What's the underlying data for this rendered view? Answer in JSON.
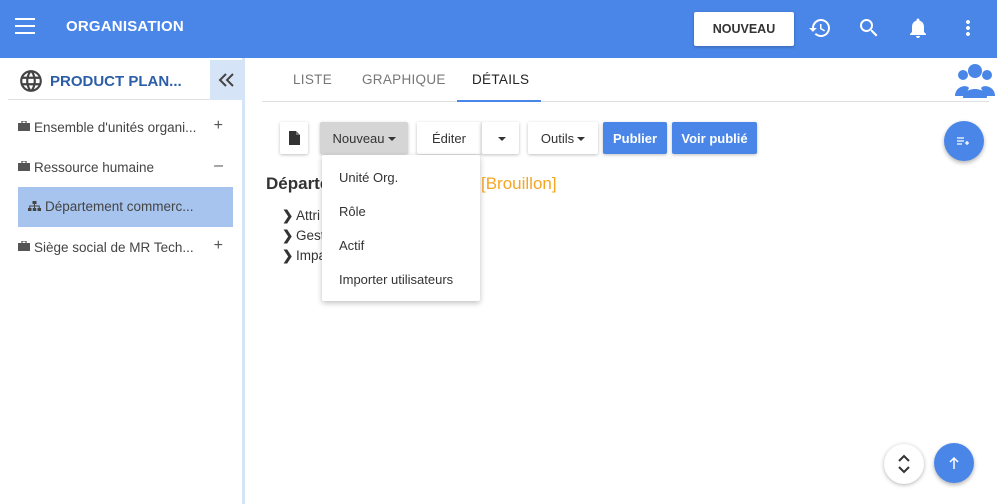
{
  "header": {
    "title": "ORGANISATION",
    "new_button": "NOUVEAU",
    "icons": [
      "menu-icon",
      "history-icon",
      "search-icon",
      "bell-icon",
      "more-vert-icon"
    ]
  },
  "sidebar": {
    "title": "PRODUCT PLAN...",
    "items": [
      {
        "label": "Ensemble d'unités organi...",
        "toggle": "+"
      },
      {
        "label": "Ressource humaine",
        "toggle": "–"
      },
      {
        "label": "Département commerc..."
      },
      {
        "label": "Siège social de MR Tech...",
        "toggle": "+"
      }
    ]
  },
  "tabs": [
    {
      "label": "LISTE"
    },
    {
      "label": "GRAPHIQUE"
    },
    {
      "label": "DÉTAILS"
    }
  ],
  "toolbar": {
    "nouveau": "Nouveau",
    "editer": "Éditer",
    "outils": "Outils",
    "publier": "Publier",
    "voir_publie": "Voir publié"
  },
  "dropdown": {
    "items": [
      "Unité Org.",
      "Rôle",
      "Actif",
      "Importer utilisateurs"
    ]
  },
  "content": {
    "title_visible": "Départe",
    "status": "[Brouillon]",
    "sections": [
      "Attri",
      "Gest",
      "Impa"
    ]
  },
  "colors": {
    "primary": "#4a86e8",
    "draft": "#f5a623",
    "selected": "#a7c4ef"
  }
}
